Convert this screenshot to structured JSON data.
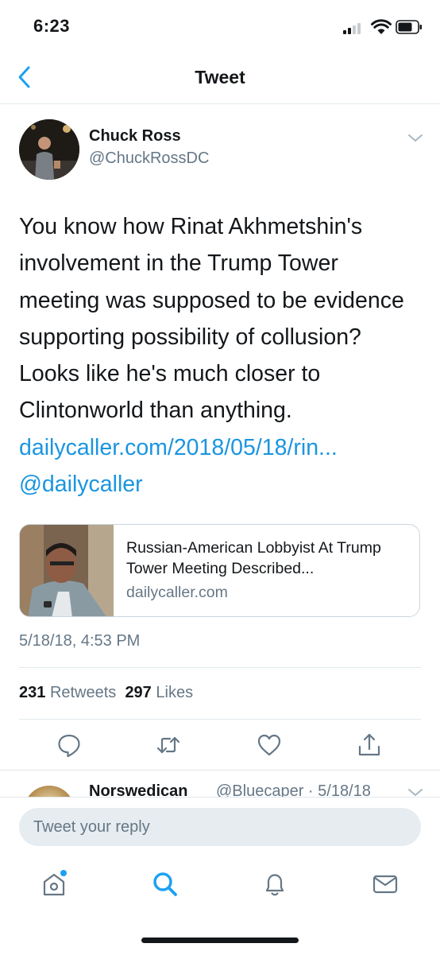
{
  "status_bar": {
    "time": "6:23"
  },
  "nav": {
    "title": "Tweet"
  },
  "tweet": {
    "author_name": "Chuck Ross",
    "author_handle": "@ChuckRossDC",
    "text": "You know how Rinat Akhmetshin's involvement in the Trump Tower meeting was supposed to be evidence supporting possibility of collusion? Looks like he's much closer to Clintonworld than anything.",
    "link": "dailycaller.com/2018/05/18/rin...",
    "mention": "@dailycaller",
    "card": {
      "title": "Russian-American Lobbyist At Trump Tower Meeting Described...",
      "domain": "dailycaller.com"
    },
    "timestamp": "5/18/18, 4:53 PM",
    "retweets_count": "231",
    "retweets_label": "Retweets",
    "likes_count": "297",
    "likes_label": "Likes"
  },
  "reply_preview": {
    "name": "Norswedican",
    "meta": "@Bluecaper · 5/18/18"
  },
  "compose": {
    "placeholder": "Tweet your reply"
  },
  "colors": {
    "link": "#1b95e0",
    "secondary": "#657786",
    "accent": "#1da1f2"
  },
  "icons": {
    "actions": [
      "reply-icon",
      "retweet-icon",
      "like-icon",
      "share-icon"
    ],
    "tabs": [
      "home-icon",
      "search-icon",
      "notifications-icon",
      "messages-icon"
    ]
  }
}
